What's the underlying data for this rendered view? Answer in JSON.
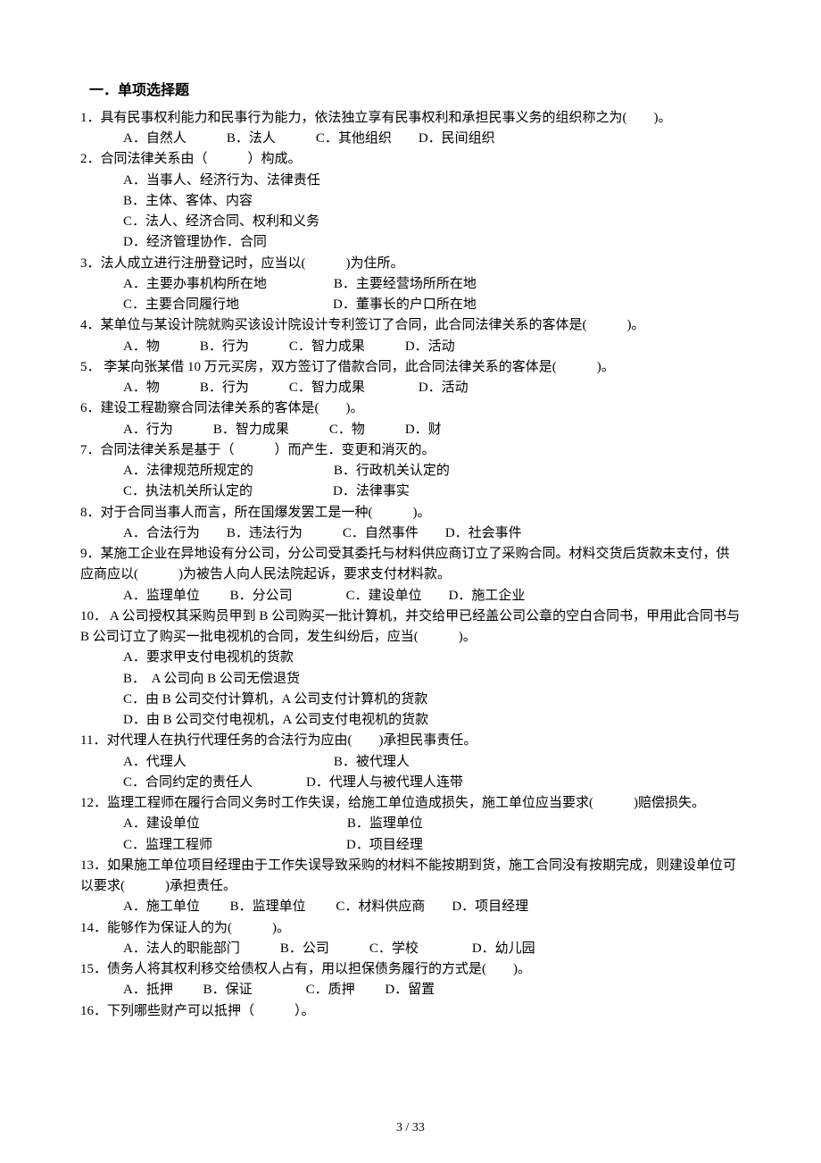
{
  "section_title": "一．单项选择题",
  "questions": [
    {
      "num": "1",
      "text": "1．具有民事权利能力和民事行为能力，依法独立享有民事权利和承担民事义务的组织称之为(　　)。",
      "opts": [
        "A．自然人　　　B．法人　　　C．其他组织　　D．民间组织"
      ]
    },
    {
      "num": "2",
      "text": "2．合同法律关系由（　　　）构成。",
      "opts": [
        "A．当事人、经济行为、法律责任",
        "B．主体、客体、内容",
        "C．法人、经济合同、权利和义务",
        "D．经济管理协作．合同"
      ]
    },
    {
      "num": "3",
      "text": "3．法人成立进行注册登记时，应当以(　　　)为住所。",
      "opts": [
        "A．主要办事机构所在地　　　　　B．主要经营场所所在地",
        "C．主要合同履行地　　　　　　　D．董事长的户口所在地"
      ]
    },
    {
      "num": "4",
      "text": "4．某单位与某设计院就购买该设计院设计专利签订了合同，此合同法律关系的客体是(　　　)。",
      "opts": [
        "A．物　　　B．行为　　　C．智力成果　　　D．活动"
      ]
    },
    {
      "num": "5",
      "text": "5．  李某向张某借 10 万元买房，双方签订了借款合同，此合同法律关系的客体是(　　　)。",
      "opts": [
        "A．物　　　B．行为　　　C．智力成果　　　　D．活动"
      ]
    },
    {
      "num": "6",
      "text": "6．建设工程勘察合同法律关系的客体是(　　)。",
      "opts": [
        "A．行为　　　B．智力成果　　　C．物　　　D．财"
      ]
    },
    {
      "num": "7",
      "text": "7．合同法律关系是基于（　　　）而产生．变更和消灭的。",
      "opts": [
        "A．法律规范所规定的　　　　　　B．行政机关认定的",
        "C．执法机关所认定的　　　　　　D．法律事实"
      ]
    },
    {
      "num": "8",
      "text": "8．对于合同当事人而言，所在国爆发罢工是一种(　　　)。",
      "opts": [
        "A．合法行为　　B．违法行为　　　C．自然事件　　D．社会事件"
      ]
    },
    {
      "num": "9",
      "text": "9．某施工企业在异地设有分公司，分公司受其委托与材料供应商订立了采购合同。材料交货后货款未支付，供应商应以(　　　)为被告人向人民法院起诉，要求支付材料款。",
      "opts": [
        "A．监理单位　　 B．分公司　　　　C．建设单位　　D．施工企业"
      ]
    },
    {
      "num": "10",
      "text": "10．  A 公司授权其采购员甲到 B 公司购买一批计算机，并交给甲已经盖公司公章的空白合同书，甲用此合同书与 B 公司订立了购买一批电视机的合同，发生纠纷后，应当(　　　)。",
      "opts": [
        "A．要求甲支付电视机的货款",
        "B．  A 公司向 B 公司无偿退货",
        "C．由 B 公司交付计算机，A 公司支付计算机的货款",
        "D．由 B 公司交付电视机，A 公司支付电视机的货款"
      ]
    },
    {
      "num": "11",
      "text": "11．对代理人在执行代理任务的合法行为应由(　　)承担民事责任。",
      "opts": [
        "A．代理人　　　　　　　　　　　B．被代理人",
        "C．合同约定的责任人　　　　D．代理人与被代理人连带"
      ]
    },
    {
      "num": "12",
      "text": "12．监理工程师在履行合同义务时工作失误，给施工单位造成损失，施工单位应当要求(　　　)赔偿损失。",
      "opts": [
        "A．建设单位　　　　　　　　　　　B．监理单位",
        "C．监理工程师　　　　　　　　　　D．项目经理"
      ]
    },
    {
      "num": "13",
      "text": "13．如果施工单位项目经理由于工作失误导致采购的材料不能按期到货，施工合同没有按期完成，则建设单位可以要求(　　　)承担责任。",
      "opts": [
        "A．施工单位　　 B．监理单位　　 C．材料供应商　　D．项目经理"
      ]
    },
    {
      "num": "14",
      "text": "14．能够作为保证人的为(　　　)。",
      "opts": [
        "A．法人的职能部门　　　B．公司　　　C．学校　　　　D．幼儿园"
      ]
    },
    {
      "num": "15",
      "text": "15．债务人将其权利移交给债权人占有，用以担保债务履行的方式是(　　)。",
      "opts": [
        "A．抵押　　 B．保证　　　　C．质押　　 D．留置"
      ]
    },
    {
      "num": "16",
      "text": "16．下列哪些财产可以抵押（　　　）。",
      "opts": []
    }
  ],
  "page_number": "3  / 33"
}
